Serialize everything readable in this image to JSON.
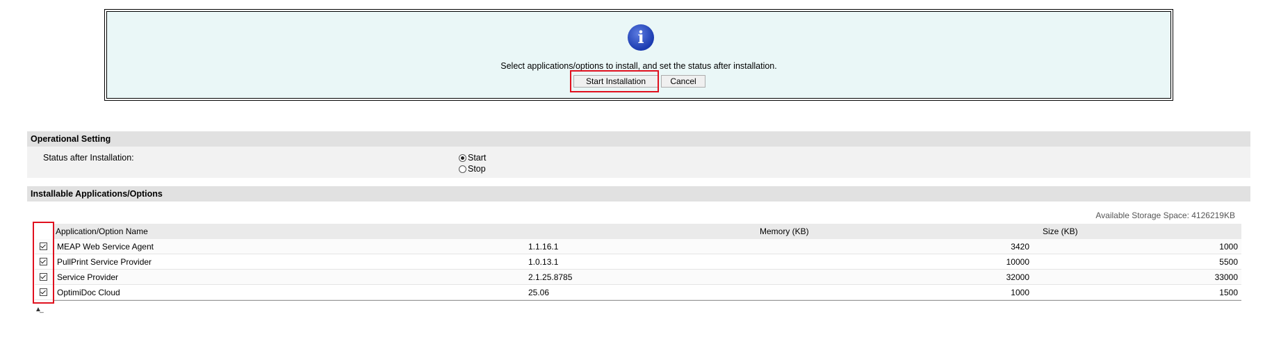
{
  "banner": {
    "message": "Select applications/options to install, and set the status after installation.",
    "start_label": "Start Installation",
    "cancel_label": "Cancel",
    "icon": "info-icon"
  },
  "operational": {
    "header": "Operational Setting",
    "status_label": "Status after Installation:",
    "options": [
      {
        "label": "Start",
        "selected": true
      },
      {
        "label": "Stop",
        "selected": false
      }
    ]
  },
  "installable": {
    "header": "Installable Applications/Options",
    "storage": "Available Storage Space: 4126219KB",
    "columns": [
      "Application/Option Name",
      "Memory (KB)",
      "Size (KB)"
    ],
    "rows": [
      {
        "checked": true,
        "name": "MEAP Web Service Agent",
        "version": "1.1.16.1",
        "memory": "3420",
        "size": "1000"
      },
      {
        "checked": true,
        "name": "PullPrint Service Provider",
        "version": "1.0.13.1",
        "memory": "10000",
        "size": "5500"
      },
      {
        "checked": true,
        "name": "Service Provider",
        "version": "2.1.25.8785",
        "memory": "32000",
        "size": "33000"
      },
      {
        "checked": true,
        "name": "OptimiDoc Cloud",
        "version": "25.06",
        "memory": "1000",
        "size": "1500"
      }
    ]
  },
  "colors": {
    "accent_highlight": "#e0101e",
    "banner_bg": "#eaf7f7"
  }
}
